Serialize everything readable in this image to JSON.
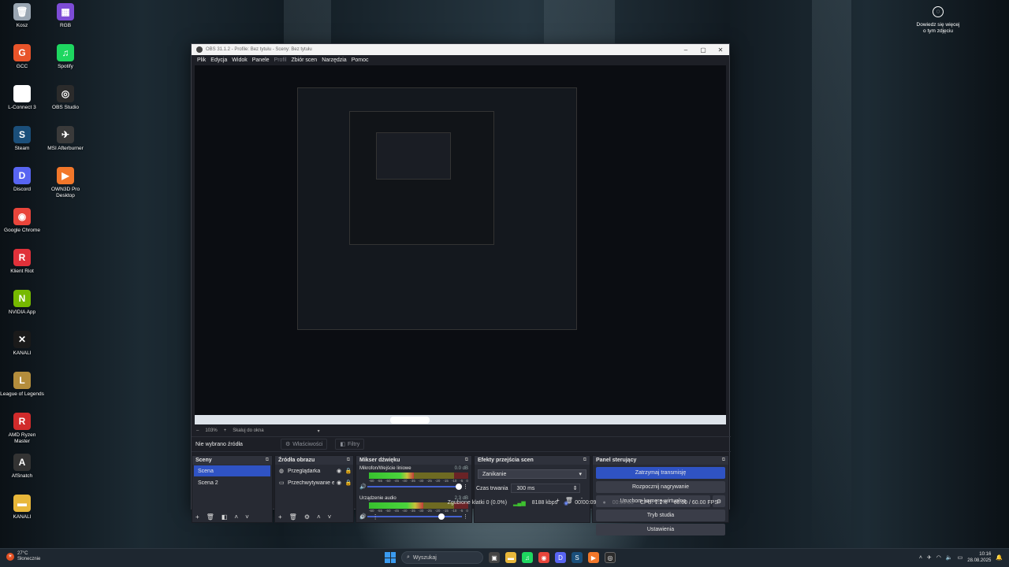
{
  "desktop": {
    "icons": [
      {
        "label": "Kosz",
        "icon": "recycle-bin-icon",
        "color": "#9aa6b2",
        "glyph": "🗑"
      },
      {
        "label": "GCC",
        "icon": "gcc-icon",
        "color": "#e8542a",
        "glyph": "G"
      },
      {
        "label": "L-Connect 3",
        "icon": "lconnect-icon",
        "color": "#ffffff",
        "glyph": "L"
      },
      {
        "label": "Steam",
        "icon": "steam-icon",
        "color": "#1b4f7a",
        "glyph": "S"
      },
      {
        "label": "Discord",
        "icon": "discord-icon",
        "color": "#5865f2",
        "glyph": "D"
      },
      {
        "label": "Google Chrome",
        "icon": "chrome-icon",
        "color": "#e9453b",
        "glyph": "◉"
      },
      {
        "label": "Klient Riot",
        "icon": "riot-icon",
        "color": "#e0313a",
        "glyph": "R"
      },
      {
        "label": "NVIDIA App",
        "icon": "nvidia-icon",
        "color": "#76b900",
        "glyph": "N"
      },
      {
        "label": "KANALI",
        "icon": "kanali-icon",
        "color": "#1a1a1a",
        "glyph": "✕"
      },
      {
        "label": "League of Legends",
        "icon": "lol-icon",
        "color": "#b48d3c",
        "glyph": "L"
      },
      {
        "label": "AMD Ryzen Master",
        "icon": "ryzen-icon",
        "color": "#d12b2b",
        "glyph": "R"
      },
      {
        "label": "AfSnatch",
        "icon": "afsnatch-icon",
        "color": "#333333",
        "glyph": "A"
      },
      {
        "label": "KANALI",
        "icon": "folder-icon",
        "color": "#e8b73a",
        "glyph": "▬"
      },
      {
        "label": "RGB",
        "icon": "rgb-icon",
        "color": "#7d4cd6",
        "glyph": "▦"
      },
      {
        "label": "Spotify",
        "icon": "spotify-icon",
        "color": "#1ed760",
        "glyph": "♫"
      },
      {
        "label": "OBS Studio",
        "icon": "obs-icon",
        "color": "#2b2b2b",
        "glyph": "◎"
      },
      {
        "label": "MSI Afterburner",
        "icon": "msi-afterburner-icon",
        "color": "#3a3a3a",
        "glyph": "✈"
      },
      {
        "label": "OWN3D Pro Desktop",
        "icon": "own3d-icon",
        "color": "#f2772a",
        "glyph": "▶"
      }
    ],
    "info_text": "Dowiedz się więcej o tym zdjęciu"
  },
  "obs": {
    "title": "OBS 31.1.2 - Profile: Bez tytułu - Sceny: Bez tytułu",
    "menu": [
      "Plik",
      "Edycja",
      "Widok",
      "Panele",
      "Profil",
      "Zbiór scen",
      "Narzędzia",
      "Pomoc"
    ],
    "zoom": "103%",
    "zoom_mode": "Skaluj do okna",
    "no_source": "Nie wybrano źródła",
    "properties_label": "Właściwości",
    "filters_label": "Filtry",
    "scenes": {
      "title": "Sceny",
      "items": [
        "Scena",
        "Scena 2"
      ],
      "selected": 0
    },
    "sources": {
      "title": "Źródła obrazu",
      "items": [
        {
          "name": "Przeglądarka",
          "icon": "globe-icon"
        },
        {
          "name": "Przechwytywanie ekranu",
          "icon": "monitor-icon"
        }
      ]
    },
    "mixer": {
      "title": "Mikser dźwięku",
      "channels": [
        {
          "name": "Mikrofon/Wejście liniowe",
          "db": "0.0 dB",
          "level": 0.45,
          "volume": 1.0
        },
        {
          "name": "Urządzenie audio",
          "db": "2.3 dB",
          "level": 0.55,
          "volume": 0.82
        }
      ],
      "scale": [
        "-60",
        "-55",
        "-50",
        "-45",
        "-40",
        "-35",
        "-30",
        "-25",
        "-20",
        "-15",
        "-10",
        "-5",
        "0"
      ]
    },
    "transitions": {
      "title": "Efekty przejścia scen",
      "selected": "Zanikanie",
      "duration_label": "Czas trwania",
      "duration": "300 ms"
    },
    "controls": {
      "title": "Panel sterujący",
      "stop_stream": "Zatrzymaj transmisję",
      "start_record": "Rozpocznij nagrywanie",
      "virtual_cam": "Uruchom kamerę wirtualną",
      "studio": "Tryb studia",
      "settings": "Ustawienia"
    },
    "status": {
      "dropped": "Zgubione klatki 0 (0.0%)",
      "bitrate": "8188 kbps",
      "stream_time": "00:00:09",
      "rec_time": "00:00:00",
      "cpu": "CPU: 1.2%",
      "fps": "60.00 / 60.00 FPS"
    }
  },
  "taskbar": {
    "weather_temp": "27°C",
    "weather_desc": "Słonecznie",
    "search_placeholder": "Wyszukaj",
    "time": "10:16",
    "date": "28.08.2025"
  }
}
